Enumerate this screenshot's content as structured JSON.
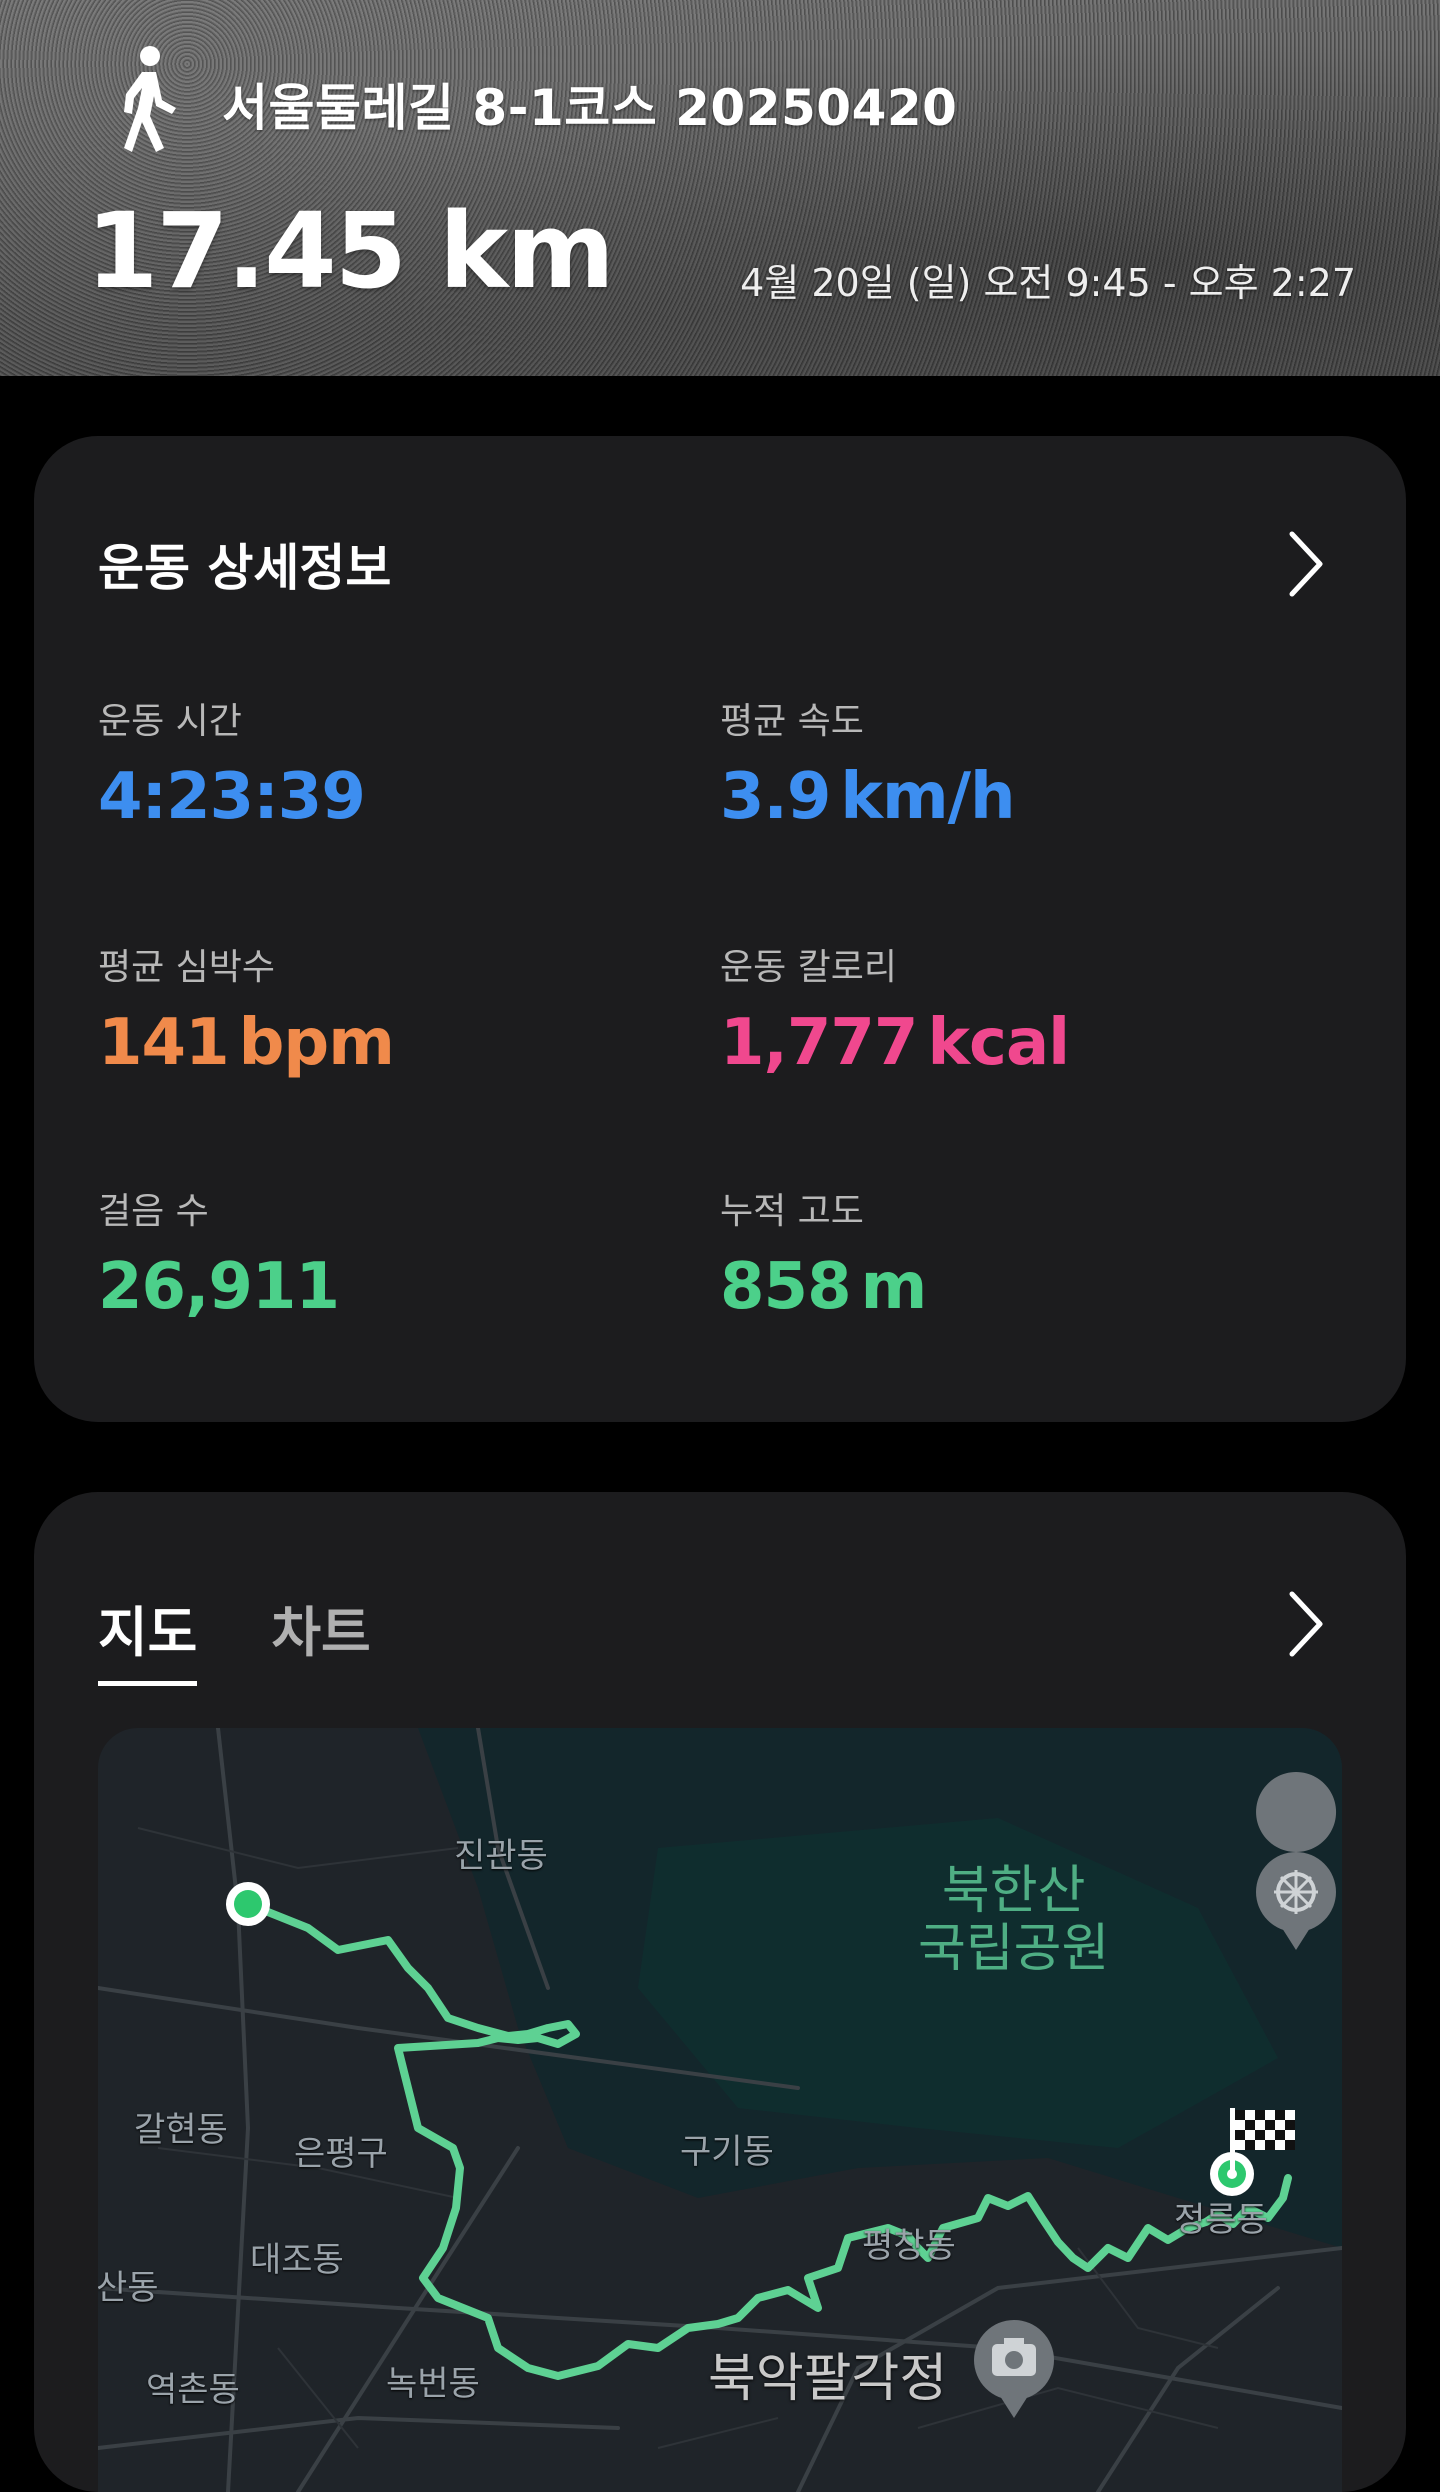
{
  "header": {
    "activity_icon": "walking-person-icon",
    "title": "서울둘레길 8-1코스 20250420",
    "distance": "17.45 km",
    "time_range": "4월 20일 (일) 오전 9:45 - 오후 2:27"
  },
  "details": {
    "title": "운동 상세정보",
    "stats": [
      {
        "label": "운동 시간",
        "value": "4:23:39",
        "unit": "",
        "color": "#3d8ef0"
      },
      {
        "label": "평균 속도",
        "value": "3.9",
        "unit": "km/h",
        "color": "#3d8ef0"
      },
      {
        "label": "평균 심박수",
        "value": "141",
        "unit": "bpm",
        "color": "#f08a4b"
      },
      {
        "label": "운동 칼로리",
        "value": "1,777",
        "unit": "kcal",
        "color": "#f0488e"
      },
      {
        "label": "걸음 수",
        "value": "26,911",
        "unit": "",
        "color": "#4cd08a"
      },
      {
        "label": "누적 고도",
        "value": "858",
        "unit": "m",
        "color": "#4cd08a"
      }
    ]
  },
  "map_card": {
    "tabs": [
      {
        "label": "지도",
        "active": true
      },
      {
        "label": "차트",
        "active": false
      }
    ],
    "map": {
      "park_line1": "북한산",
      "park_line2": "국립공원",
      "places": [
        "진관동",
        "갈현동",
        "은평구",
        "구기동",
        "대조동",
        "평창동",
        "정릉동",
        "산동",
        "역촌동",
        "녹번동"
      ],
      "poi": "북악팔각정",
      "route_color": "#5ed193"
    }
  },
  "colors": {
    "card_bg": "#1c1c1e",
    "page_bg": "#000000"
  }
}
